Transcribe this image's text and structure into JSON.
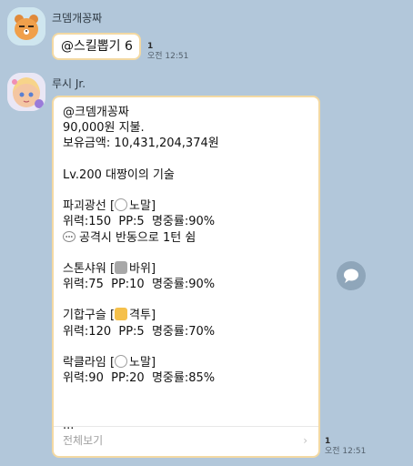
{
  "messages": [
    {
      "sender": "크뎀개꽁짜",
      "text": "@스킬뽑기 6",
      "unread": "1",
      "time": "오전 12:51"
    },
    {
      "sender": "루시 Jr.",
      "lines": {
        "l1": "@크뎀개꽁짜",
        "l2": "90,000원 지불.",
        "l3": "보유금액: 10,431,204,374원",
        "l4": "Lv.200 대짱이의 기술",
        "s1_name": "파괴광선 [",
        "s1_type": "노말]",
        "s1_stats": "위력:150  PP:5  명중률:90%",
        "s1_note": "공격시 반동으로 1턴 쉼",
        "s2_name": "스톤샤워 [",
        "s2_type": "바위]",
        "s2_stats": "위력:75  PP:10  명중률:90%",
        "s3_name": "기합구슬 [",
        "s3_type": "격투]",
        "s3_stats": "위력:120  PP:5  명중률:70%",
        "s4_name": "락클라임 [",
        "s4_type": "노말]",
        "s4_stats": "위력:90  PP:20  명중률:85%",
        "ellipsis": "..."
      },
      "see_all": "전체보기",
      "see_all_arrow": "›",
      "unread": "1",
      "time": "오전 12:51"
    }
  ],
  "icons": {
    "sender1_avatar": "ryan-avatar-icon",
    "sender2_avatar": "anime-girl-avatar-icon",
    "normal_type": "normal-type-icon",
    "rock_type": "rock-type-icon",
    "fighting_type": "fist-icon",
    "speech": "speech-bubble-icon",
    "share": "share-icon"
  },
  "colors": {
    "background": "#b2c7da",
    "bubble": "#ffffff",
    "bubble_border": "#f3d9a3",
    "share_button": "#8fa6ba"
  }
}
